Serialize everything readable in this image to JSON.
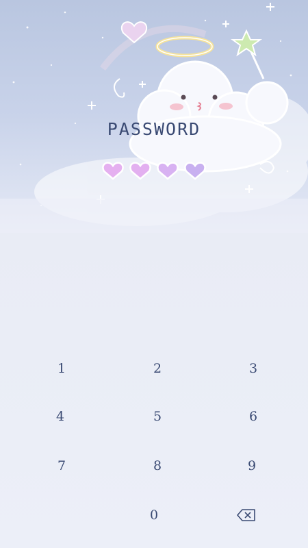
{
  "lock": {
    "title": "PASSWORD"
  },
  "keypad": {
    "keys": [
      "1",
      "2",
      "3",
      "4",
      "5",
      "6",
      "7",
      "8",
      "9",
      "0"
    ],
    "delete_icon": "backspace-icon"
  },
  "pin": {
    "entered": 4,
    "length": 4
  },
  "colors": {
    "text": "#3a4a73",
    "heart_pink": "#e5b0f0",
    "heart_purple": "#c8b0f0",
    "background": "#eceff8"
  }
}
